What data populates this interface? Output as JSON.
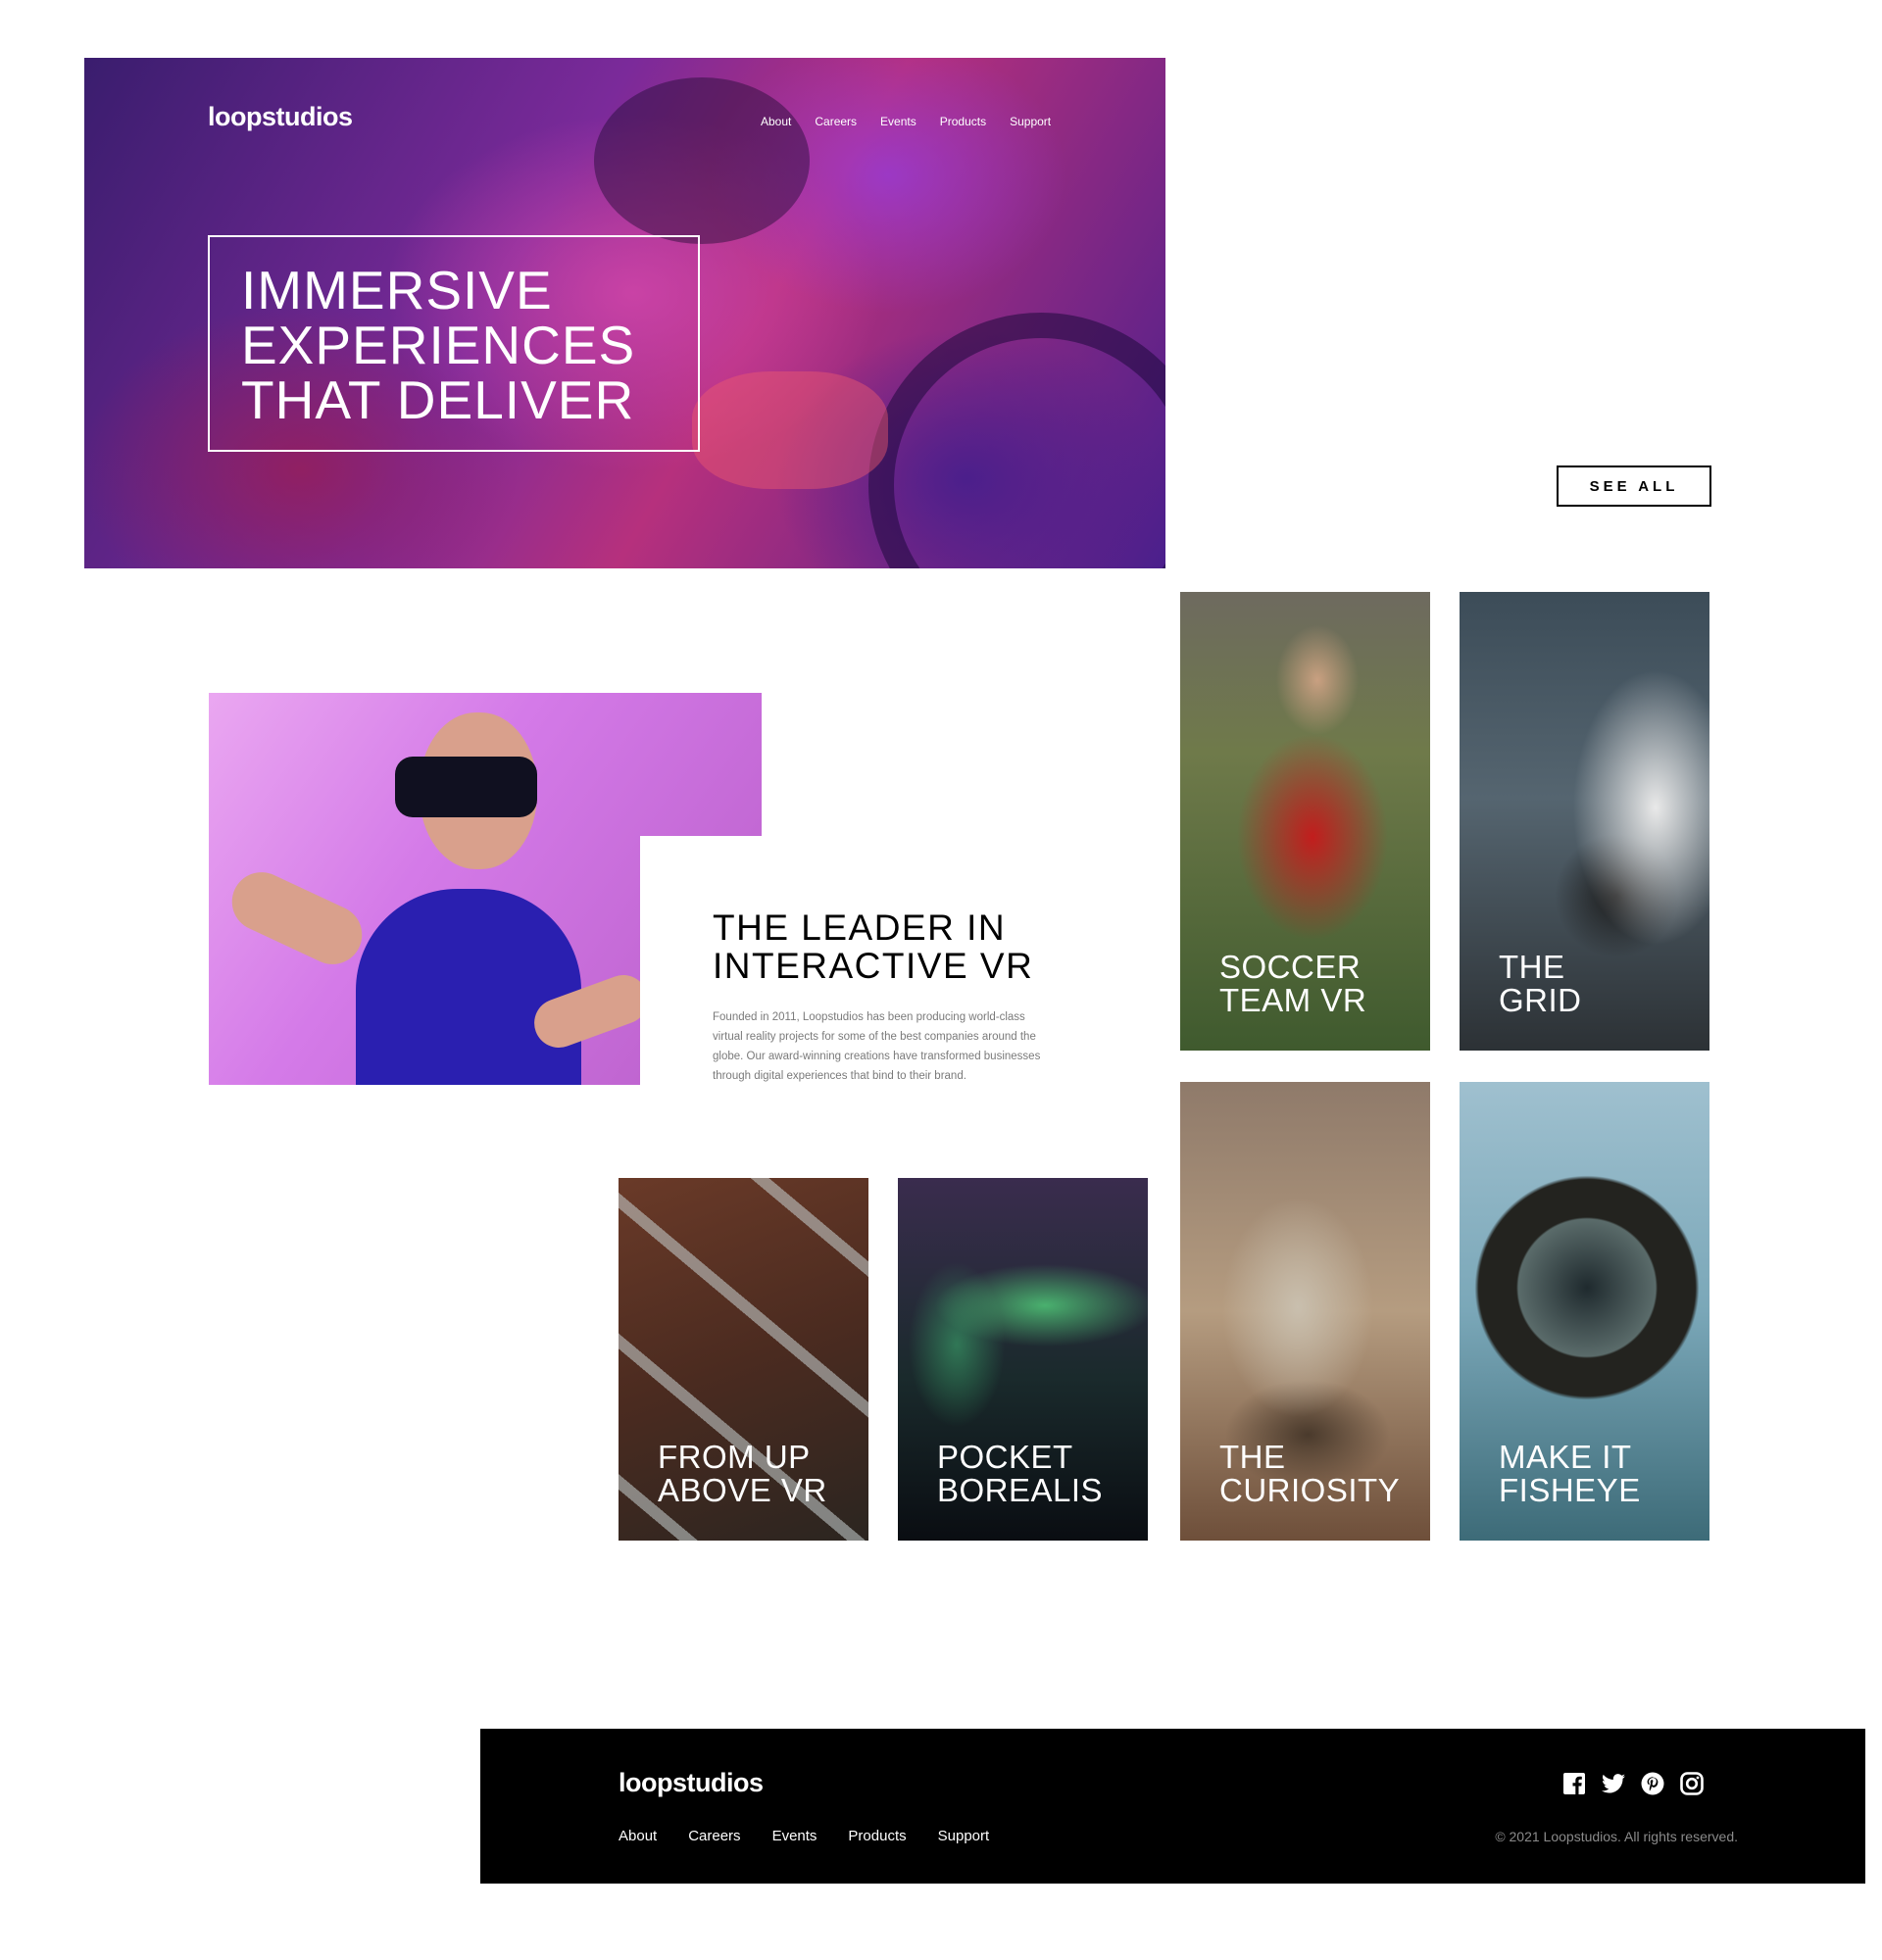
{
  "hero": {
    "logo": "loopstudios",
    "nav": [
      "About",
      "Careers",
      "Events",
      "Products",
      "Support"
    ],
    "title_lines": [
      "IMMERSIVE",
      "EXPERIENCES",
      "THAT DELIVER"
    ]
  },
  "see_all_label": "SEE ALL",
  "interactive": {
    "title_lines": [
      "THE LEADER IN",
      "INTERACTIVE VR"
    ],
    "text": "Founded in 2011, Loopstudios has been producing world-class virtual reality projects for some of the best companies around the globe. Our award-winning creations have transformed businesses through digital experiences that bind to their brand."
  },
  "creations": [
    {
      "id": "soccer",
      "lines": [
        "SOCCER",
        "TEAM VR"
      ]
    },
    {
      "id": "grid",
      "lines": [
        "THE",
        "GRID"
      ]
    },
    {
      "id": "fromup",
      "lines": [
        "FROM UP",
        "ABOVE VR"
      ]
    },
    {
      "id": "pocket",
      "lines": [
        "POCKET",
        "BOREALIS"
      ]
    },
    {
      "id": "curiosity",
      "lines": [
        "THE",
        "CURIOSITY"
      ]
    },
    {
      "id": "fisheye",
      "lines": [
        "MAKE IT",
        "FISHEYE"
      ]
    }
  ],
  "footer": {
    "logo": "loopstudios",
    "nav": [
      "About",
      "Careers",
      "Events",
      "Products",
      "Support"
    ],
    "social_icons": [
      "facebook-icon",
      "twitter-icon",
      "pinterest-icon",
      "instagram-icon"
    ],
    "copyright": "© 2021 Loopstudios. All rights reserved."
  }
}
